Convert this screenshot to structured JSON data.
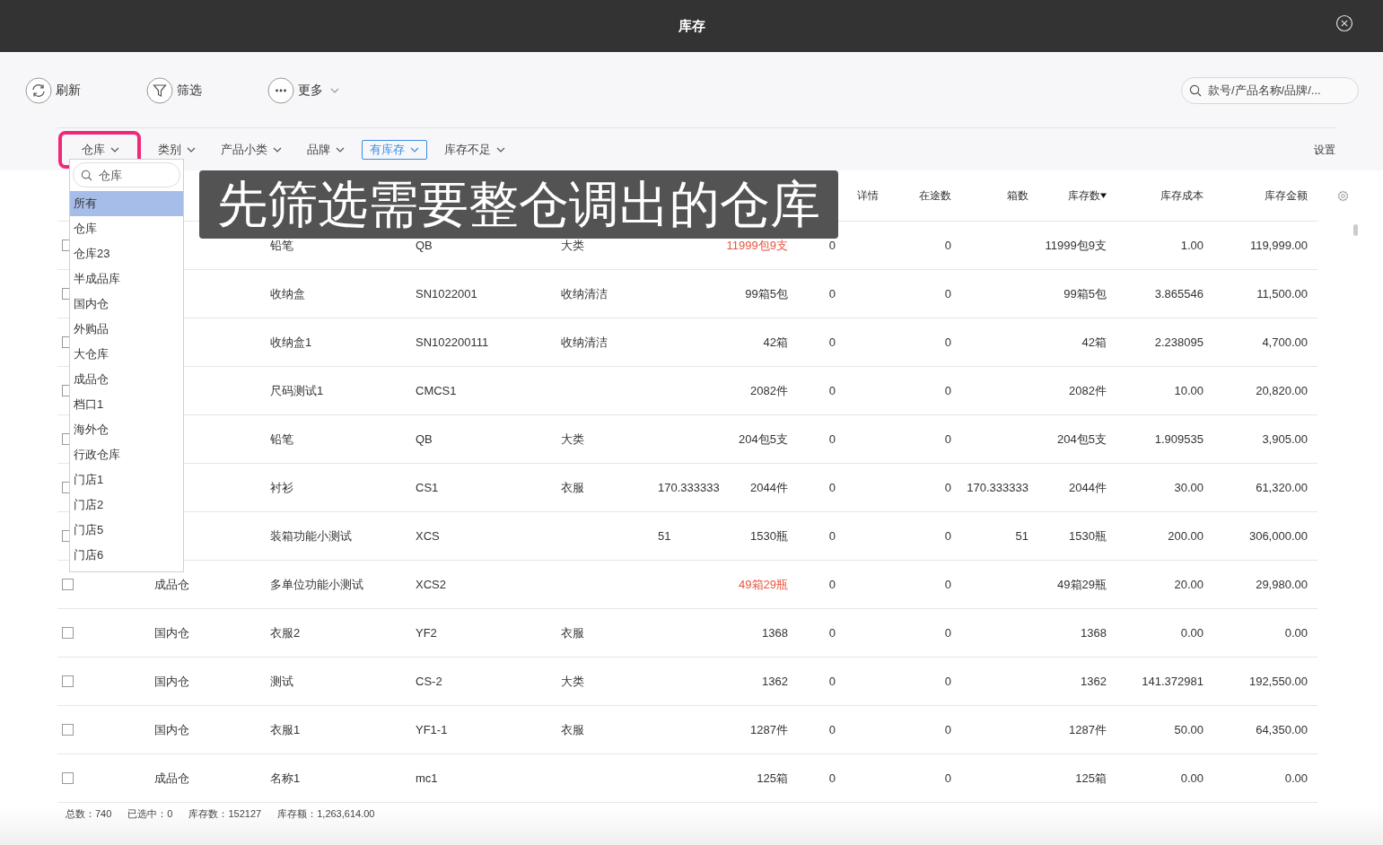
{
  "window": {
    "title": "库存"
  },
  "toolbar": [
    {
      "label": "刷新",
      "kind": "refresh"
    },
    {
      "label": "筛选",
      "kind": "filter"
    },
    {
      "label": "更多",
      "kind": "more"
    }
  ],
  "search": {
    "placeholder": "款号/产品名称/品牌/..."
  },
  "filters": [
    {
      "label": "仓库",
      "selected": false,
      "highlighted": true
    },
    {
      "label": "类别",
      "selected": false,
      "highlighted": false
    },
    {
      "label": "产品小类",
      "selected": false,
      "highlighted": false
    },
    {
      "label": "品牌",
      "selected": false,
      "highlighted": false
    },
    {
      "label": "有库存",
      "selected": true,
      "highlighted": false
    },
    {
      "label": "库存不足",
      "selected": false,
      "highlighted": false
    }
  ],
  "settings_label": "设置",
  "dropdown": {
    "placeholder": "仓库",
    "items": [
      {
        "label": "所有",
        "selected": true
      },
      {
        "label": "仓库",
        "selected": false
      },
      {
        "label": "仓库23",
        "selected": false
      },
      {
        "label": "半成品库",
        "selected": false
      },
      {
        "label": "国内仓",
        "selected": false
      },
      {
        "label": "外购品",
        "selected": false
      },
      {
        "label": "大仓库",
        "selected": false
      },
      {
        "label": "成品仓",
        "selected": false
      },
      {
        "label": "档口1",
        "selected": false
      },
      {
        "label": "海外仓",
        "selected": false
      },
      {
        "label": "行政仓库",
        "selected": false
      },
      {
        "label": "门店1",
        "selected": false
      },
      {
        "label": "门店2",
        "selected": false
      },
      {
        "label": "门店5",
        "selected": false
      },
      {
        "label": "门店6",
        "selected": false
      }
    ]
  },
  "caption": "先筛选需要整仓调出的仓库",
  "table": {
    "columns": [
      null,
      null,
      null,
      null,
      null,
      null,
      null,
      {
        "label": "详情",
        "sorted": false
      },
      {
        "label": "在途数",
        "sorted": false
      },
      {
        "label": "箱数",
        "sorted": false
      },
      {
        "label": "库存数",
        "sorted": true
      },
      {
        "label": "库存成本",
        "sorted": false
      },
      {
        "label": "库存金额",
        "sorted": false
      }
    ],
    "rows": [
      {
        "checked": false,
        "short": true,
        "cells": [
          null,
          "铅笔",
          "QB",
          "大类",
          null,
          "11999包9支",
          "0",
          null,
          "0",
          null,
          "11999包9支",
          "1.00",
          "119,999.00"
        ]
      },
      {
        "checked": false,
        "short": false,
        "cells": [
          null,
          "收纳盒",
          "SN1022001",
          "收纳清洁",
          null,
          "99箱5包",
          "0",
          null,
          "0",
          null,
          "99箱5包",
          "3.865546",
          "11,500.00"
        ]
      },
      {
        "checked": false,
        "short": false,
        "cells": [
          null,
          "收纳盒1",
          "SN102200111",
          "收纳清洁",
          null,
          "42箱",
          "0",
          null,
          "0",
          null,
          "42箱",
          "2.238095",
          "4,700.00"
        ]
      },
      {
        "checked": false,
        "short": false,
        "cells": [
          null,
          "尺码测试1",
          "CMCS1",
          null,
          null,
          "2082件",
          "0",
          null,
          "0",
          null,
          "2082件",
          "10.00",
          "20,820.00"
        ]
      },
      {
        "checked": false,
        "short": false,
        "cells": [
          null,
          "铅笔",
          "QB",
          "大类",
          null,
          "204包5支",
          "0",
          null,
          "0",
          null,
          "204包5支",
          "1.909535",
          "3,905.00"
        ]
      },
      {
        "checked": false,
        "short": false,
        "cells": [
          null,
          "衬衫",
          "CS1",
          "衣服",
          "170.333333",
          "2044件",
          "0",
          null,
          "0",
          "170.333333",
          "2044件",
          "30.00",
          "61,320.00"
        ]
      },
      {
        "checked": false,
        "short": false,
        "cells": [
          null,
          "装箱功能小测试",
          "XCS",
          null,
          "51",
          "1530瓶",
          "0",
          null,
          "0",
          "51",
          "1530瓶",
          "200.00",
          "306,000.00"
        ]
      },
      {
        "checked": false,
        "short": true,
        "cells": [
          "成品仓",
          "多单位功能小测试",
          "XCS2",
          null,
          null,
          "49箱29瓶",
          "0",
          null,
          "0",
          null,
          "49箱29瓶",
          "20.00",
          "29,980.00"
        ]
      },
      {
        "checked": false,
        "short": false,
        "cells": [
          "国内仓",
          "衣服2",
          "YF2",
          "衣服",
          null,
          "1368",
          "0",
          null,
          "0",
          null,
          "1368",
          "0.00",
          "0.00"
        ]
      },
      {
        "checked": false,
        "short": false,
        "cells": [
          "国内仓",
          "测试",
          "CS-2",
          "大类",
          null,
          "1362",
          "0",
          null,
          "0",
          null,
          "1362",
          "141.372981",
          "192,550.00"
        ]
      },
      {
        "checked": false,
        "short": false,
        "cells": [
          "国内仓",
          "衣服1",
          "YF1-1",
          "衣服",
          null,
          "1287件",
          "0",
          null,
          "0",
          null,
          "1287件",
          "50.00",
          "64,350.00"
        ]
      },
      {
        "checked": false,
        "short": false,
        "cells": [
          "成品仓",
          "名称1",
          "mc1",
          null,
          null,
          "125箱",
          "0",
          null,
          "0",
          null,
          "125箱",
          "0.00",
          "0.00"
        ]
      }
    ]
  },
  "summary": [
    {
      "label": "总数：",
      "value": "740"
    },
    {
      "label": "已选中：",
      "value": "0"
    },
    {
      "label": "库存数：",
      "value": "152127"
    },
    {
      "label": "库存额：",
      "value": "1,263,614.00"
    }
  ]
}
